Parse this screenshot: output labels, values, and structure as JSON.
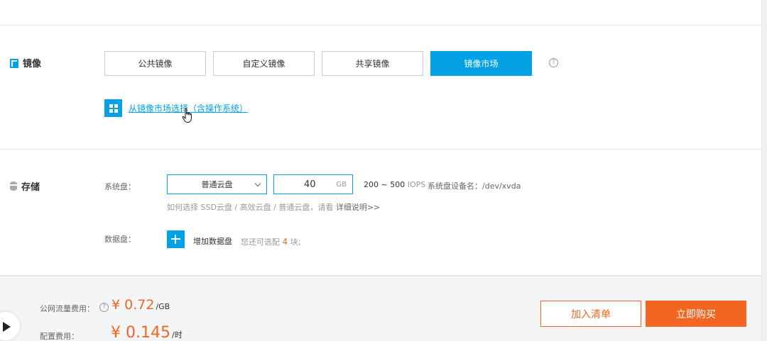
{
  "top_cut_text": "··· ··· ··· · ·· ··· ·· · ··",
  "image_section": {
    "title": "镜像",
    "tabs": [
      {
        "label": "公共镜像",
        "active": false
      },
      {
        "label": "自定义镜像",
        "active": false
      },
      {
        "label": "共享镜像",
        "active": false
      },
      {
        "label": "镜像市场",
        "active": true
      }
    ],
    "help_glyph": "?",
    "market_link": "从镜像市场选择（含操作系统）"
  },
  "storage_section": {
    "title": "存储",
    "system_disk_label": "系统盘：",
    "disk_type_selected": "普通云盘",
    "disk_size_value": "40",
    "disk_size_unit": "GB",
    "iops_range": "200 ~ 500",
    "iops_unit": "IOPS",
    "device_name": "系统盘设备名：/dev/xvda",
    "hint_text": "如何选择 SSD云盘 / 高效云盘 / 普通云盘，请看",
    "hint_link": "详细说明>>",
    "data_disk_label": "数据盘：",
    "add_data_disk": "增加数据盘",
    "remaining_prefix": "您还可选配",
    "remaining_count": "4",
    "remaining_suffix": "块;"
  },
  "footer": {
    "traffic_fee_label": "公网流量费用：",
    "traffic_price": "¥ 0.72",
    "traffic_unit": "/GB",
    "config_fee_label": "配置费用：",
    "config_price": "¥ 0.145",
    "config_unit": "/时",
    "add_to_cart": "加入清单",
    "buy_now": "立即购买"
  },
  "colors": {
    "accent": "#00a2e5",
    "orange": "#f26522",
    "footer_bg": "#f3f5f7"
  }
}
